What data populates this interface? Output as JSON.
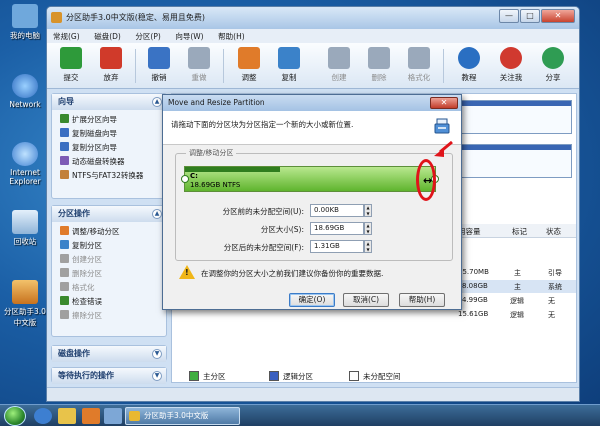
{
  "desktop": {
    "icons": [
      {
        "label": "我的电脑",
        "color": "#6fa8dc"
      },
      {
        "label": "Network",
        "color": "#4f7fbf"
      },
      {
        "label": "Internet Explorer",
        "color": "#3d7fd1"
      },
      {
        "label": "回收站",
        "color": "#a9c8e6"
      },
      {
        "label": "分区助手3.0中文版",
        "color": "#d8932a"
      }
    ]
  },
  "taskbar": {
    "task_label": "分区助手3.0中文版",
    "tray_text": ""
  },
  "app": {
    "title": "分区助手3.0中文版(稳定、易用且免费)",
    "window_buttons": {
      "minimize": "—",
      "maximize": "□",
      "close": "✕"
    },
    "menu": [
      "常规(G)",
      "磁盘(D)",
      "分区(P)",
      "向导(W)",
      "帮助(H)"
    ],
    "toolbar": [
      {
        "label": "提交",
        "icon": "check-icon",
        "color": "#2e9a3a",
        "disabled": false
      },
      {
        "label": "放弃",
        "icon": "x-icon",
        "color": "#d03a2a",
        "disabled": false
      },
      {
        "label": "撤销",
        "icon": "undo-icon",
        "color": "#3a73c4",
        "disabled": false
      },
      {
        "label": "重做",
        "icon": "redo-icon",
        "color": "#9aa9bb",
        "disabled": true
      },
      {
        "label": "调整",
        "icon": "resize-icon",
        "color": "#e07b2a",
        "disabled": false
      },
      {
        "label": "复制",
        "icon": "copy-icon",
        "color": "#3b82c9",
        "disabled": false
      },
      {
        "label": "创建",
        "icon": "create-icon",
        "color": "#9aa9bb",
        "disabled": true
      },
      {
        "label": "删除",
        "icon": "delete-icon",
        "color": "#9aa9bb",
        "disabled": true
      },
      {
        "label": "格式化",
        "icon": "format-icon",
        "color": "#9aa9bb",
        "disabled": true
      },
      {
        "label": "教程",
        "icon": "tutorial-icon",
        "color": "#2a6fc2",
        "disabled": false
      },
      {
        "label": "关注我",
        "icon": "follow-icon",
        "color": "#d0392f",
        "disabled": false
      },
      {
        "label": "分享",
        "icon": "share-icon",
        "color": "#2f9c53",
        "disabled": false
      }
    ],
    "wizard_panel": {
      "title": "向导",
      "items": [
        {
          "label": "扩展分区向导",
          "disabled": false,
          "color": "#3a8a2e"
        },
        {
          "label": "复制磁盘向导",
          "disabled": false,
          "color": "#3b6fc2"
        },
        {
          "label": "复制分区向导",
          "disabled": false,
          "color": "#3b6fc2"
        },
        {
          "label": "动态磁盘转换器",
          "disabled": false,
          "color": "#7d5bb5"
        },
        {
          "label": "NTFS与FAT32转换器",
          "disabled": false,
          "color": "#c2803b"
        }
      ]
    },
    "partition_panel": {
      "title": "分区操作",
      "items": [
        {
          "label": "调整/移动分区",
          "disabled": false,
          "color": "#e07b2a"
        },
        {
          "label": "复制分区",
          "disabled": false,
          "color": "#3b82c9"
        },
        {
          "label": "创建分区",
          "disabled": true,
          "color": "#a0a0a0"
        },
        {
          "label": "删除分区",
          "disabled": true,
          "color": "#a0a0a0"
        },
        {
          "label": "格式化",
          "disabled": true,
          "color": "#a0a0a0"
        },
        {
          "label": "检查错误",
          "disabled": false,
          "color": "#3a8a2e"
        },
        {
          "label": "擦除分区",
          "disabled": true,
          "color": "#a0a0a0"
        }
      ]
    },
    "disk_panel": {
      "title": "磁盘操作"
    },
    "pending_panel": {
      "title": "等待执行的操作"
    },
    "table": {
      "headers": [
        "用容量",
        "标记",
        "状态"
      ],
      "rows": [
        {
          "cells": [
            "75.70MB",
            "主",
            "引导"
          ],
          "selected": false
        },
        {
          "cells": [
            "8.08GB",
            "主",
            "系统"
          ],
          "selected": true
        },
        {
          "cells": [
            "4.99GB",
            "逻辑",
            "无"
          ],
          "selected": false
        },
        {
          "cells": [
            "15.61GB",
            "逻辑",
            "无"
          ],
          "selected": false
        }
      ]
    },
    "legend": [
      {
        "label": "主分区",
        "color": "#3fae3f"
      },
      {
        "label": "逻辑分区",
        "color": "#3a5fbf"
      },
      {
        "label": "未分配空间",
        "color": "#ffffff"
      }
    ]
  },
  "dialog": {
    "title": "Move and Resize Partition",
    "close": "✕",
    "message": "请拖动下面的分区块为分区指定一个新的大小或新位置.",
    "group_label": "调整/移动分区",
    "partition": {
      "name": "C:",
      "info": "18.69GB NTFS",
      "used_fraction": 0.38
    },
    "fields": [
      {
        "label": "分区前的未分配空间(U):",
        "value": "0.00KB"
      },
      {
        "label": "分区大小(S):",
        "value": "18.69GB"
      },
      {
        "label": "分区后的未分配空间(F):",
        "value": "1.31GB"
      }
    ],
    "warning": "在调整你的分区大小之前我们建议你备份你的重要数据.",
    "buttons": {
      "ok": "确定(O)",
      "cancel": "取消(C)",
      "help": "帮助(H)"
    },
    "accent": "#e0141a"
  }
}
